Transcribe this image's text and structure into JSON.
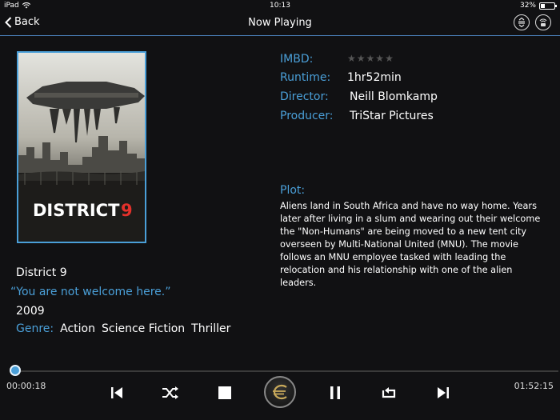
{
  "statusbar": {
    "device": "iPad",
    "time": "10:13",
    "battery": "32%",
    "battery_level": 0.32
  },
  "navbar": {
    "back_label": "Back",
    "title": "Now Playing"
  },
  "poster": {
    "title_text": "DISTRICT",
    "title_num": "9"
  },
  "info": {
    "imdb_label": "IMBD:",
    "imdb_stars": 0,
    "runtime_label": "Runtime:",
    "runtime": "1hr52min",
    "director_label": "Director:",
    "director": "Neill Blomkamp",
    "producer_label": "Producer:",
    "producer": "TriStar Pictures"
  },
  "plot": {
    "label": "Plot:",
    "text": "Aliens land in South Africa and have no way home. Years later after living in a slum and wearing out their welcome the \"Non-Humans\" are being moved to a new tent city overseen by Multi-National United (MNU). The movie follows an MNU employee tasked with leading the relocation and his relationship with one of the alien leaders."
  },
  "movie": {
    "title": "District 9",
    "tagline": "“You are not welcome here.”",
    "year": "2009",
    "genre_label": "Genre:",
    "genres": [
      "Action",
      "Science Fiction",
      "Thriller"
    ]
  },
  "player": {
    "elapsed": "00:00:18",
    "remaining": "01:52:15",
    "progress": 0.004
  },
  "colors": {
    "accent": "#4a9fd8",
    "background": "#111113"
  }
}
